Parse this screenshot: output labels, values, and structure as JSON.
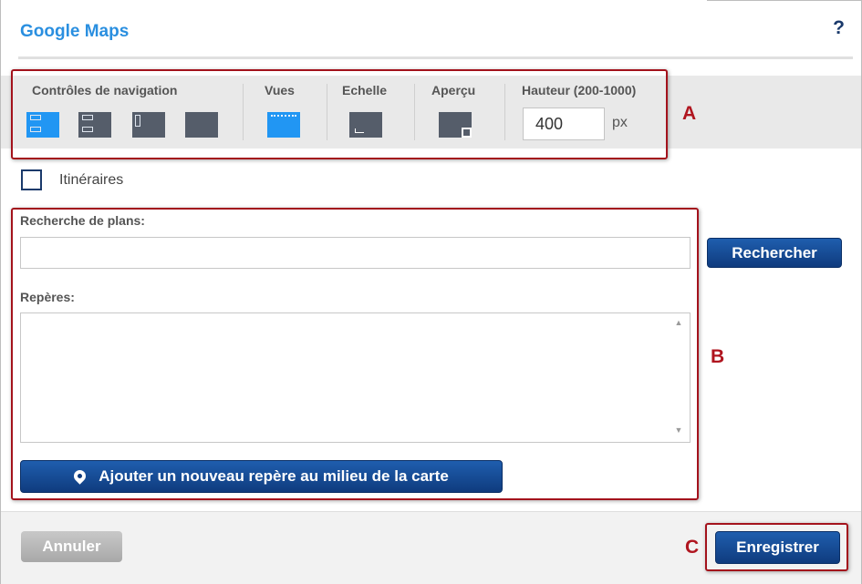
{
  "dialog": {
    "title": "Google Maps",
    "help_label": "?"
  },
  "toolbar": {
    "navigation_label": "Contrôles de navigation",
    "views_label": "Vues",
    "scale_label": "Echelle",
    "overview_label": "Aperçu",
    "height_label": "Hauteur (200-1000)",
    "height_value": "400",
    "height_unit": "px"
  },
  "annotations": {
    "a": "A",
    "b": "B",
    "c": "C",
    "color": "#a3121c"
  },
  "routes": {
    "label": "Itinéraires",
    "checked": false
  },
  "search": {
    "label": "Recherche de plans:",
    "value": "",
    "button": "Rechercher"
  },
  "markers": {
    "label": "Repères:",
    "value": "",
    "add_button": "Ajouter un nouveau repère au milieu de la carte"
  },
  "footer": {
    "cancel": "Annuler",
    "save": "Enregistrer"
  },
  "colors": {
    "accent": "#2a8fe0",
    "primary_button": "#0f3b7e",
    "active_control": "#2196f3"
  }
}
